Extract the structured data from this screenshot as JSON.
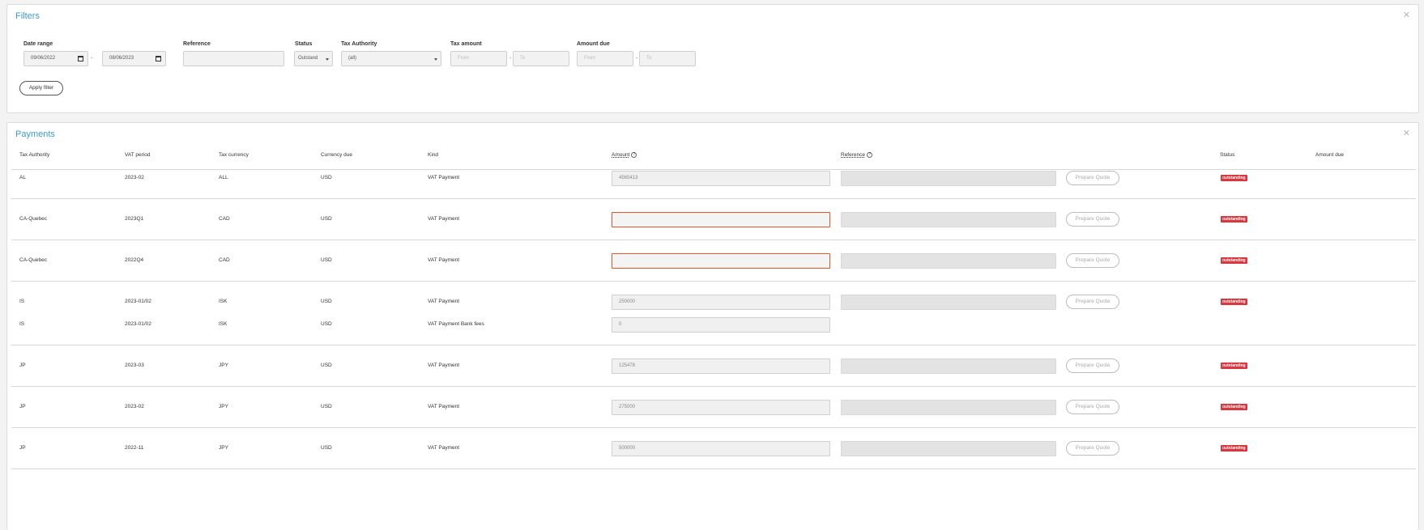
{
  "filters": {
    "title": "Filters",
    "close_icon": "close-icon",
    "date_range_label": "Date range",
    "date_from": "09/06/2022",
    "date_to": "08/06/2023",
    "date_sep": "-",
    "reference_label": "Reference",
    "reference_value": "",
    "status_label": "Status",
    "status_value": "Outstand",
    "tax_authority_label": "Tax Authority",
    "tax_authority_value": "(all)",
    "tax_amount_label": "Tax amount",
    "tax_amount_from_placeholder": "From",
    "tax_amount_to_placeholder": "To",
    "amount_due_label": "Amount due",
    "amount_due_from_placeholder": "From",
    "amount_due_to_placeholder": "To",
    "range_sep": "-",
    "apply_label": "Apply filter"
  },
  "payments": {
    "title": "Payments",
    "close_icon": "close-icon",
    "headers": {
      "tax_authority": "Tax Authority",
      "vat_period": "VAT period",
      "tax_currency": "Tax currency",
      "currency_due": "Currency due",
      "kind": "Kind",
      "amount": "Amount",
      "reference": "Reference",
      "status": "Status",
      "amount_due": "Amount due",
      "help_icon": "?"
    },
    "prepare_quote_label": "Prepare Quote",
    "rows": [
      {
        "authority": "AL",
        "period": "2023-02",
        "tax_currency": "ALL",
        "currency_due": "USD",
        "kind": "VAT Payment",
        "amount": "4565413",
        "status": "outstanding"
      },
      {
        "authority": "CA-Quebec",
        "period": "2023Q1",
        "tax_currency": "CAD",
        "currency_due": "USD",
        "kind": "VAT Payment",
        "amount": "",
        "status": "outstanding"
      },
      {
        "authority": "CA-Quebec",
        "period": "2022Q4",
        "tax_currency": "CAD",
        "currency_due": "USD",
        "kind": "VAT Payment",
        "amount": "",
        "status": "outstanding"
      },
      {
        "authority": "IS",
        "period": "2023-01/02",
        "tax_currency": "ISK",
        "currency_due": "USD",
        "kind": "VAT Payment",
        "amount": "250000",
        "status": "outstanding"
      },
      {
        "authority": "IS",
        "period": "2023-01/02",
        "tax_currency": "ISK",
        "currency_due": "USD",
        "kind": "VAT Payment Bank fees",
        "amount": "0"
      },
      {
        "authority": "JP",
        "period": "2023-03",
        "tax_currency": "JPY",
        "currency_due": "USD",
        "kind": "VAT Payment",
        "amount": "125478",
        "status": "outstanding"
      },
      {
        "authority": "JP",
        "period": "2023-02",
        "tax_currency": "JPY",
        "currency_due": "USD",
        "kind": "VAT Payment",
        "amount": "275000",
        "status": "outstanding"
      },
      {
        "authority": "JP",
        "period": "2022-11",
        "tax_currency": "JPY",
        "currency_due": "USD",
        "kind": "VAT Payment",
        "amount": "500000",
        "status": "outstanding"
      }
    ]
  },
  "colors": {
    "accent": "#3a9ad9",
    "error_border": "#e2542a",
    "status_badge": "#d9363e"
  }
}
